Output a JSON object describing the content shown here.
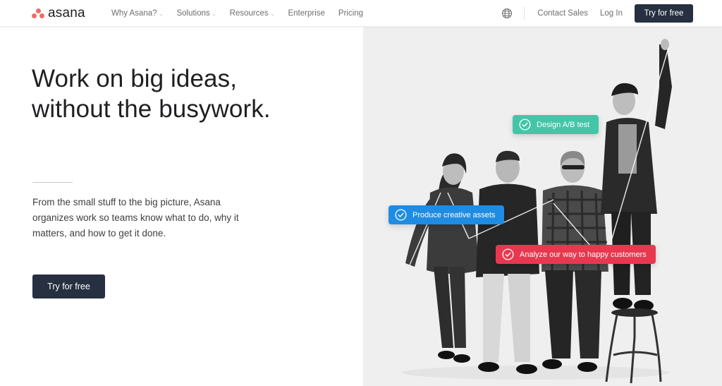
{
  "nav": {
    "brand": "asana",
    "links": [
      {
        "label": "Why Asana?",
        "has_dropdown": true
      },
      {
        "label": "Solutions",
        "has_dropdown": true
      },
      {
        "label": "Resources",
        "has_dropdown": true
      },
      {
        "label": "Enterprise",
        "has_dropdown": false
      },
      {
        "label": "Pricing",
        "has_dropdown": false
      }
    ],
    "language_icon": "globe-icon",
    "contact_sales": "Contact Sales",
    "log_in": "Log In",
    "cta": "Try for free",
    "chevron": "⌄"
  },
  "hero": {
    "title_line1": "Work on big ideas,",
    "title_line2": "without the busywork.",
    "body": "From the small stuff to the big picture, Asana organizes work so teams know what to do, why it matters, and how to get it done.",
    "cta": "Try for free"
  },
  "image": {
    "description": "Black and white photo of four colleagues connected by strings, one standing on a stool",
    "tasks": [
      {
        "label": "Design A/B test",
        "color": "#45c5a8",
        "icon": "check-circle-icon"
      },
      {
        "label": "Produce creative assets",
        "color": "#1f8ce3",
        "icon": "check-circle-icon"
      },
      {
        "label": "Analyze our way to happy customers",
        "color": "#e8384f",
        "icon": "check-circle-icon"
      }
    ]
  },
  "colors": {
    "brand_coral": "#f06a6a",
    "button_dark": "#263040"
  }
}
